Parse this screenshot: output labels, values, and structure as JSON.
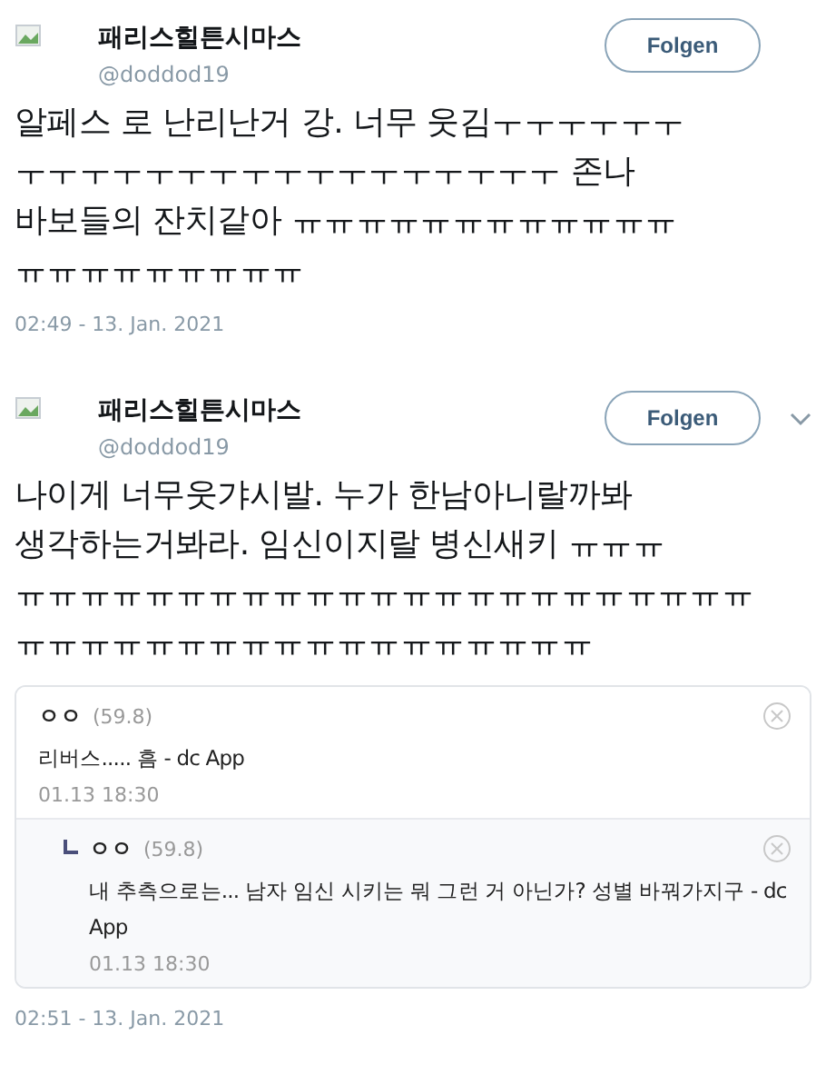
{
  "tweets": [
    {
      "name": "패리스힐튼시마스",
      "handle": "@doddod19",
      "follow_label": "Folgen",
      "menu": false,
      "body_lines": [
        "알페스 로 난리난거 강. 너무 웃김ㅜㅜㅜㅜㅜㅜ",
        "ㅜㅜㅜㅜㅜㅜㅜㅜㅜㅜㅜㅜㅜㅜㅜㅜㅜ 존나",
        "바보들의 잔치같아 ㅠㅠㅠㅠㅠㅠㅠㅠㅠㅠㅠㅠ",
        "ㅠㅠㅠㅠㅠㅠㅠㅠㅠ"
      ],
      "timestamp": "02:49 - 13. Jan. 2021"
    },
    {
      "name": "패리스힐튼시마스",
      "handle": "@doddod19",
      "follow_label": "Folgen",
      "menu": true,
      "body_lines": [
        "나이게 너무웃갸시발.  누가 한남아니랄까봐",
        "생각하는거봐라. 임신이지랄 병신새키 ㅠㅠㅠ",
        "ㅠㅠㅠㅠㅠㅠㅠㅠㅠㅠㅠㅠㅠㅠㅠㅠㅠㅠㅠㅠㅠㅠㅠ",
        "ㅠㅠㅠㅠㅠㅠㅠㅠㅠㅠㅠㅠㅠㅠㅠㅠㅠㅠ"
      ],
      "comments": [
        {
          "kind": "comment",
          "author": "ㅇㅇ",
          "score": "(59.8)",
          "text": "리버스..... 흠 - dc App",
          "time": "01.13 18:30"
        },
        {
          "kind": "reply",
          "author": "ㅇㅇ",
          "score": "(59.8)",
          "text": "내 추측으로는... 남자 임신 시키는 뭐 그런 거 아닌가? 성별 바꿔가지구 - dc App",
          "time": "01.13 18:30"
        }
      ],
      "timestamp": "02:51 - 13. Jan. 2021"
    }
  ]
}
